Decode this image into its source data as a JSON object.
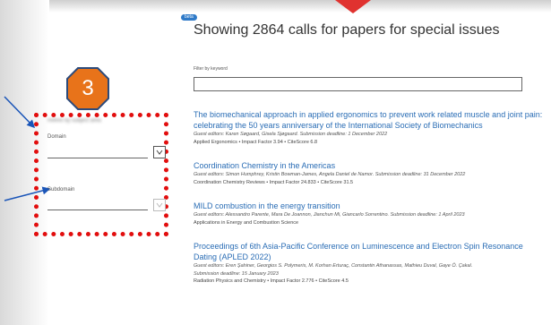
{
  "badge_label": "beta",
  "page_title": "Showing 2864 calls for papers for special issues",
  "filter": {
    "label": "Filter by keyword",
    "value": ""
  },
  "callout_number": "3",
  "facets": {
    "heading": "Refine by subject area",
    "domain_label": "Domain",
    "subdomain_label": "Subdomain"
  },
  "colors": {
    "link": "#2a6db5",
    "annotation_red": "#e20e0e",
    "callout_orange": "#e8731a",
    "beta_blue": "#2f7ac8"
  },
  "calls": [
    {
      "title": "The biomechanical approach in applied ergonomics to prevent work related muscle and joint pain: celebrating the 50 years anniversary of the International Society of Biomechanics",
      "editors": "Guest editors: Karen Søgaard, Gisela Sjøgaard. Submission deadline: 1 December 2022",
      "deadline": "",
      "journal": "Applied Ergonomics • Impact Factor 3.94 • CiteScore 6.8"
    },
    {
      "title": "Coordination Chemistry in the Americas",
      "editors": "Guest editors: Simon Humphrey, Kristin Bowman-James, Angela Daniel de Namor. Submission deadline: 31 December 2022",
      "deadline": "",
      "journal": "Coordination Chemistry Reviews • Impact Factor 24.833 • CiteScore 31.5"
    },
    {
      "title": "MILD combustion in the energy transition",
      "editors": "Guest editors: Alessandro Parente, Mara De Joannon, Jianchun Mi, Giancarlo Sorrentino. Submission deadline: 1 April 2023",
      "deadline": "",
      "journal": "Applications in Energy and Combustion Science"
    },
    {
      "title": "Proceedings of 6th Asia-Pacific Conference on Luminescence and Electron Spin Resonance Dating (APLED 2022)",
      "editors": "Guest editors: Eren Şahiner, Georgios S. Polymeris, M. Korhan Erturaç, Constantin Athanassas, Mathieu Duval, Gaye Ö. Çakal.",
      "deadline": "Submission deadline: 15 January 2023",
      "journal": "Radiation Physics and Chemistry • Impact Factor 2.776 • CiteScore 4.5"
    }
  ]
}
